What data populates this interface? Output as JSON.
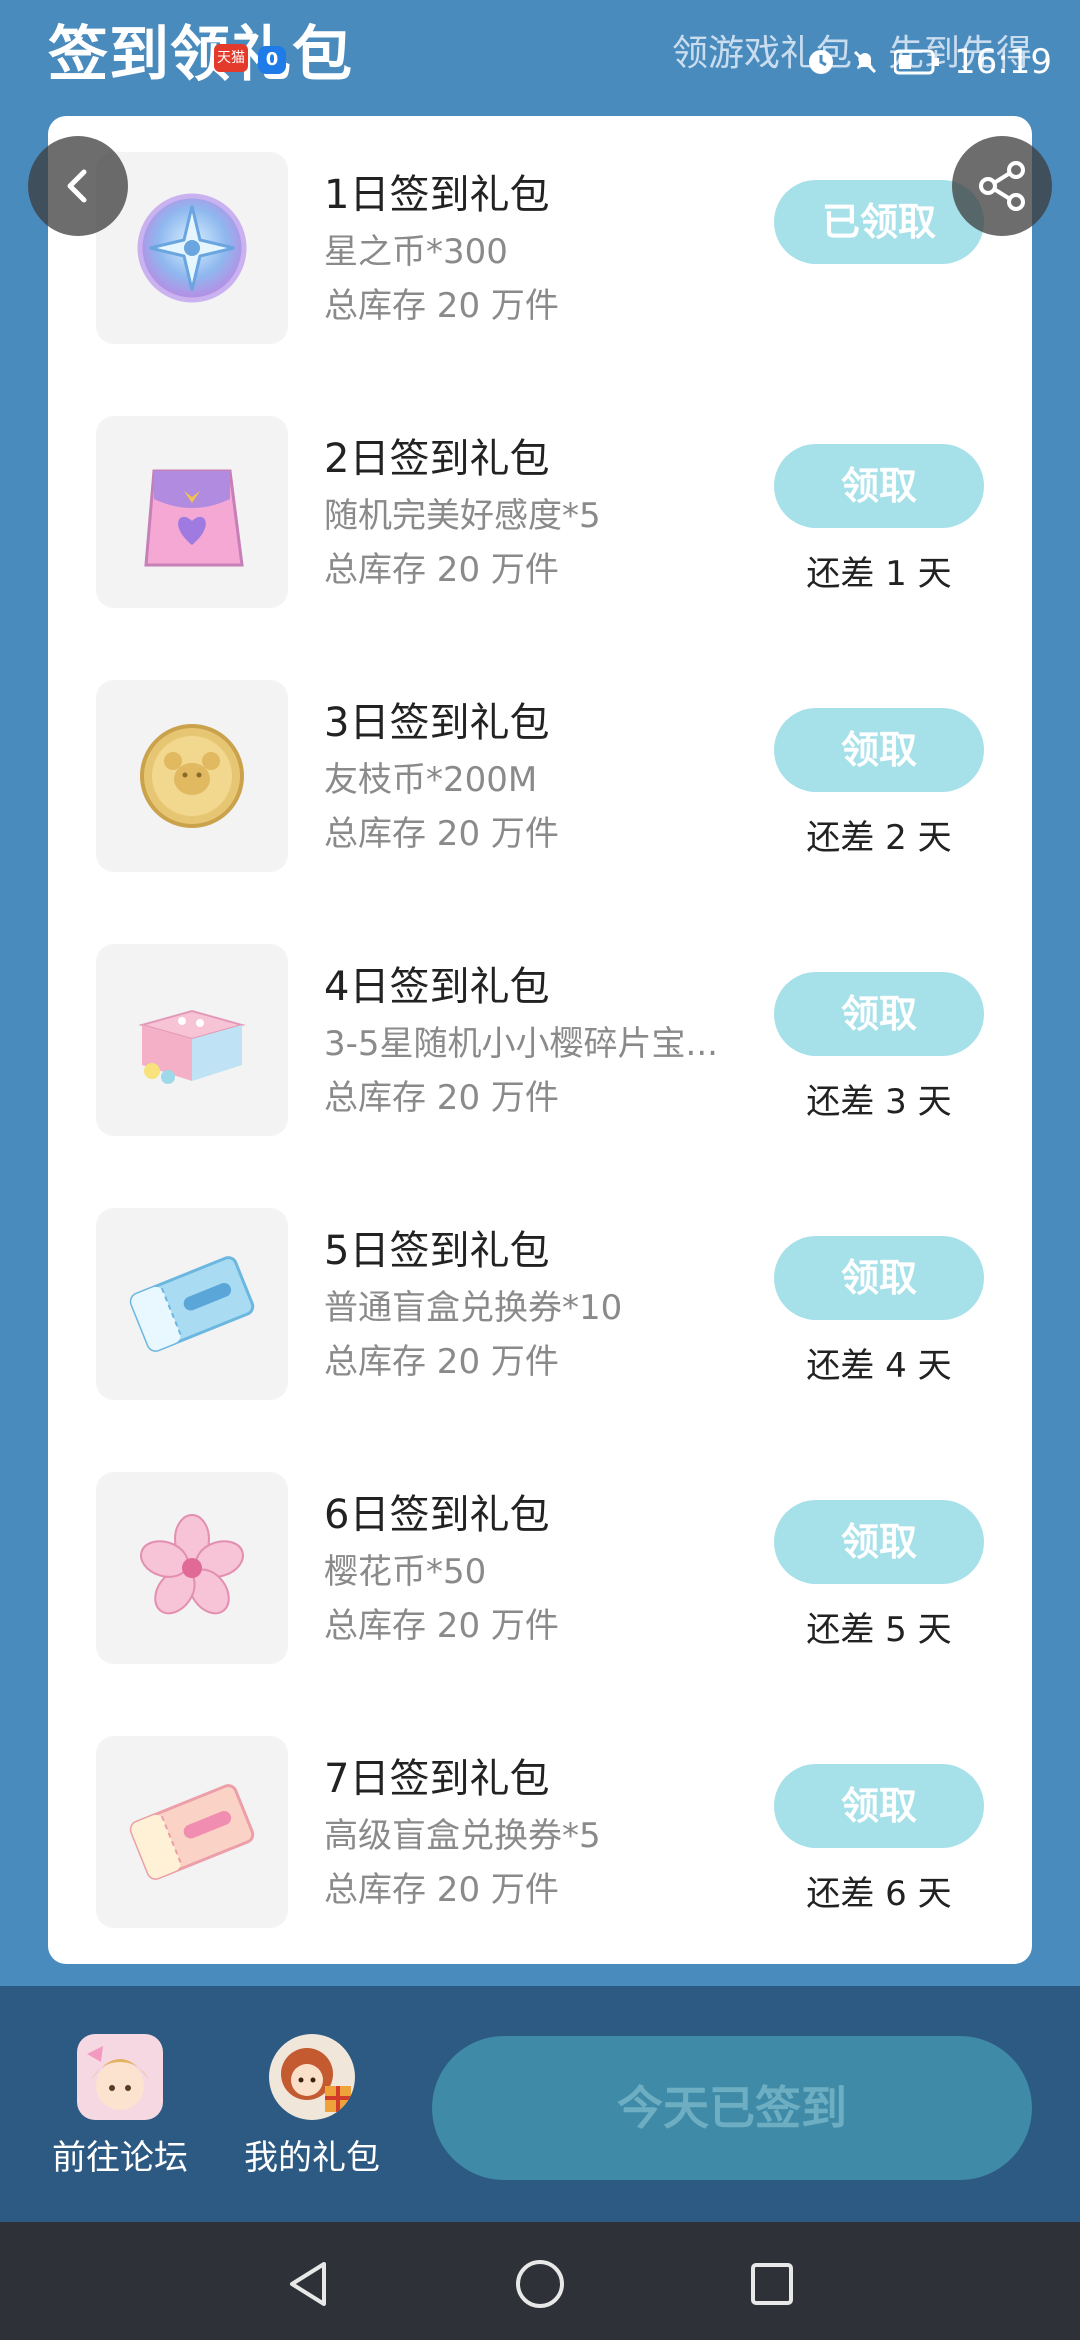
{
  "header": {
    "title": "签到领礼包",
    "subtitle": "领游戏礼包，先到先得",
    "status": {
      "time": "16:19",
      "icons": [
        "clock-icon",
        "mute-icon",
        "battery-icon"
      ]
    }
  },
  "gifts": [
    {
      "title": "1日签到礼包",
      "item": "星之币*300",
      "stock": "总库存 20 万件",
      "button": "已领取",
      "remain": ""
    },
    {
      "title": "2日签到礼包",
      "item": "随机完美好感度*5",
      "stock": "总库存 20 万件",
      "button": "领取",
      "remain": "还差 1 天"
    },
    {
      "title": "3日签到礼包",
      "item": "友枝币*200M",
      "stock": "总库存 20 万件",
      "button": "领取",
      "remain": "还差 2 天"
    },
    {
      "title": "4日签到礼包",
      "item": "3-5星随机小小樱碎片宝...",
      "stock": "总库存 20 万件",
      "button": "领取",
      "remain": "还差 3 天"
    },
    {
      "title": "5日签到礼包",
      "item": "普通盲盒兑换券*10",
      "stock": "总库存 20 万件",
      "button": "领取",
      "remain": "还差 4 天"
    },
    {
      "title": "6日签到礼包",
      "item": "樱花币*50",
      "stock": "总库存 20 万件",
      "button": "领取",
      "remain": "还差 5 天"
    },
    {
      "title": "7日签到礼包",
      "item": "高级盲盒兑换券*5",
      "stock": "总库存 20 万件",
      "button": "领取",
      "remain": "还差 6 天"
    }
  ],
  "bottom": {
    "forum_label": "前往论坛",
    "mygifts_label": "我的礼包",
    "signed_label": "今天已签到"
  },
  "colors": {
    "page_bg": "#4a8bbd",
    "button": "#a6e1ea",
    "bottom_bar": "#2d5a82",
    "signed_button": "#3f8aa6"
  }
}
